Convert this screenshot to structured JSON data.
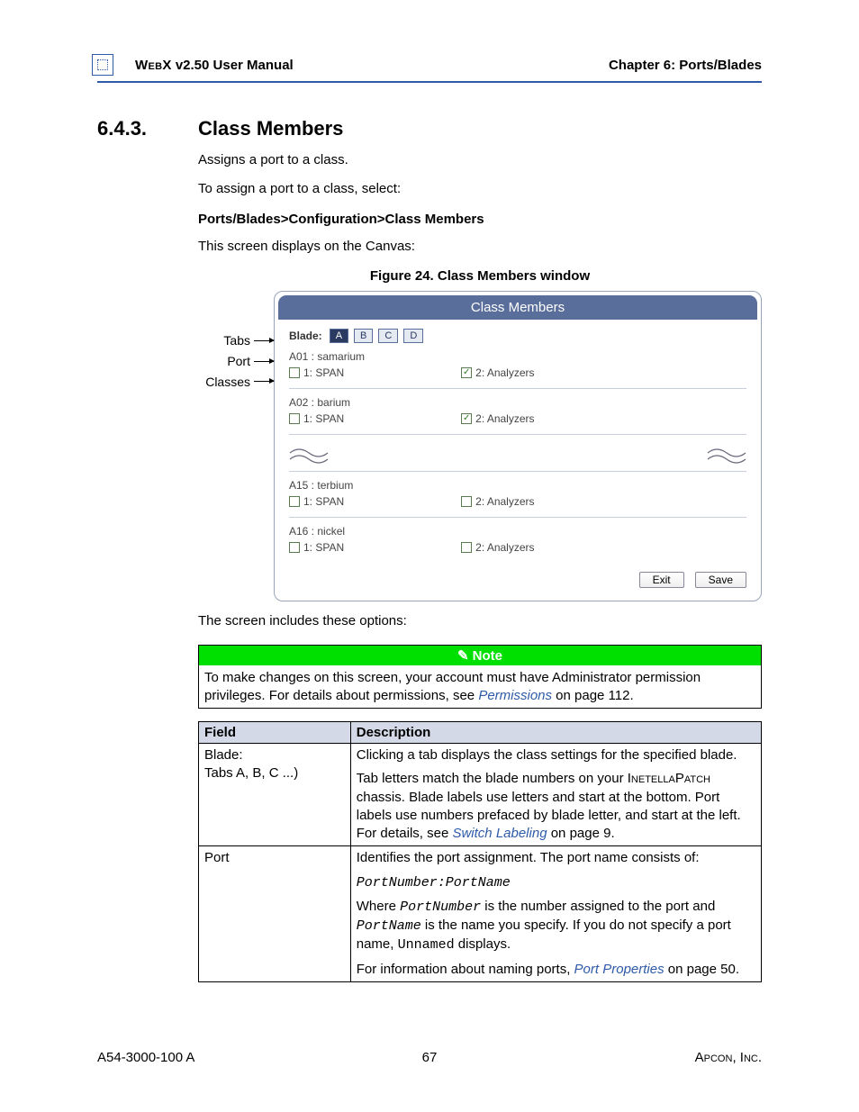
{
  "header": {
    "product_sc": "WebX",
    "version_suffix": " v2.50 User Manual",
    "chapter": "Chapter 6: Ports/Blades"
  },
  "section": {
    "number": "6.4.3.",
    "title": "Class Members",
    "para1": "Assigns a port to a class.",
    "para2": "To assign a port to a class, select:",
    "breadcrumb": "Ports/Blades>Configuration>Class Members",
    "para3": "This screen displays on the Canvas:",
    "figure_caption": "Figure 24. Class Members window",
    "options_intro": "The screen includes these options:"
  },
  "callouts": {
    "tabs": "Tabs",
    "port": "Port",
    "classes": "Classes"
  },
  "chart_data": {
    "type": "table",
    "title": "Class Members",
    "blade_label": "Blade:",
    "tabs": [
      "A",
      "B",
      "C",
      "D"
    ],
    "active_tab": "A",
    "classes": [
      "1: SPAN",
      "2: Analyzers"
    ],
    "ports": [
      {
        "name": "A01 : samarium",
        "checked": [
          false,
          true
        ]
      },
      {
        "name": "A02 : barium",
        "checked": [
          false,
          true
        ]
      },
      {
        "name": "A15 : terbium",
        "checked": [
          false,
          false
        ]
      },
      {
        "name": "A16 : nickel",
        "checked": [
          false,
          false
        ]
      }
    ],
    "break_after_row_index": 1,
    "buttons": {
      "exit": "Exit",
      "save": "Save"
    }
  },
  "note": {
    "heading": "Note",
    "body_pre": "To make changes on this screen, your account must have Administrator permission privileges. For details about permissions, see ",
    "link": "Permissions",
    "body_post": " on page 112."
  },
  "fields_table": {
    "headers": {
      "field": "Field",
      "description": "Description"
    },
    "rows": [
      {
        "field_line1": "Blade:",
        "field_line2": "Tabs A, B, C ...)",
        "desc1": "Clicking a tab displays the class settings for the specified blade.",
        "desc2_pre": "Tab letters match the blade numbers on your ",
        "desc2_sc": "InetellaPatch",
        "desc2_post": " chassis. Blade labels use letters and start at the bottom. Port labels use numbers prefaced by blade letter, and start at the left. For details, see ",
        "desc2_link": "Switch Labeling",
        "desc2_tail": " on page 9."
      },
      {
        "field_line1": "Port",
        "desc1": "Identifies the port assignment. The port name consists of:",
        "code": "PortNumber:PortName",
        "desc3_a": "Where ",
        "desc3_pn": "PortNumber",
        "desc3_b": " is the number assigned to the port and ",
        "desc3_pname": "PortName",
        "desc3_c": " is the name you specify. If you do not specify a port name, ",
        "desc3_un": "Unnamed",
        "desc3_d": " displays.",
        "desc4_pre": "For information about naming ports, ",
        "desc4_link": "Port Properties",
        "desc4_post": " on page 50."
      }
    ]
  },
  "footer": {
    "doc_id": "A54-3000-100 A",
    "page": "67",
    "company_sc": "Apcon",
    "company_suffix": ", Inc."
  }
}
